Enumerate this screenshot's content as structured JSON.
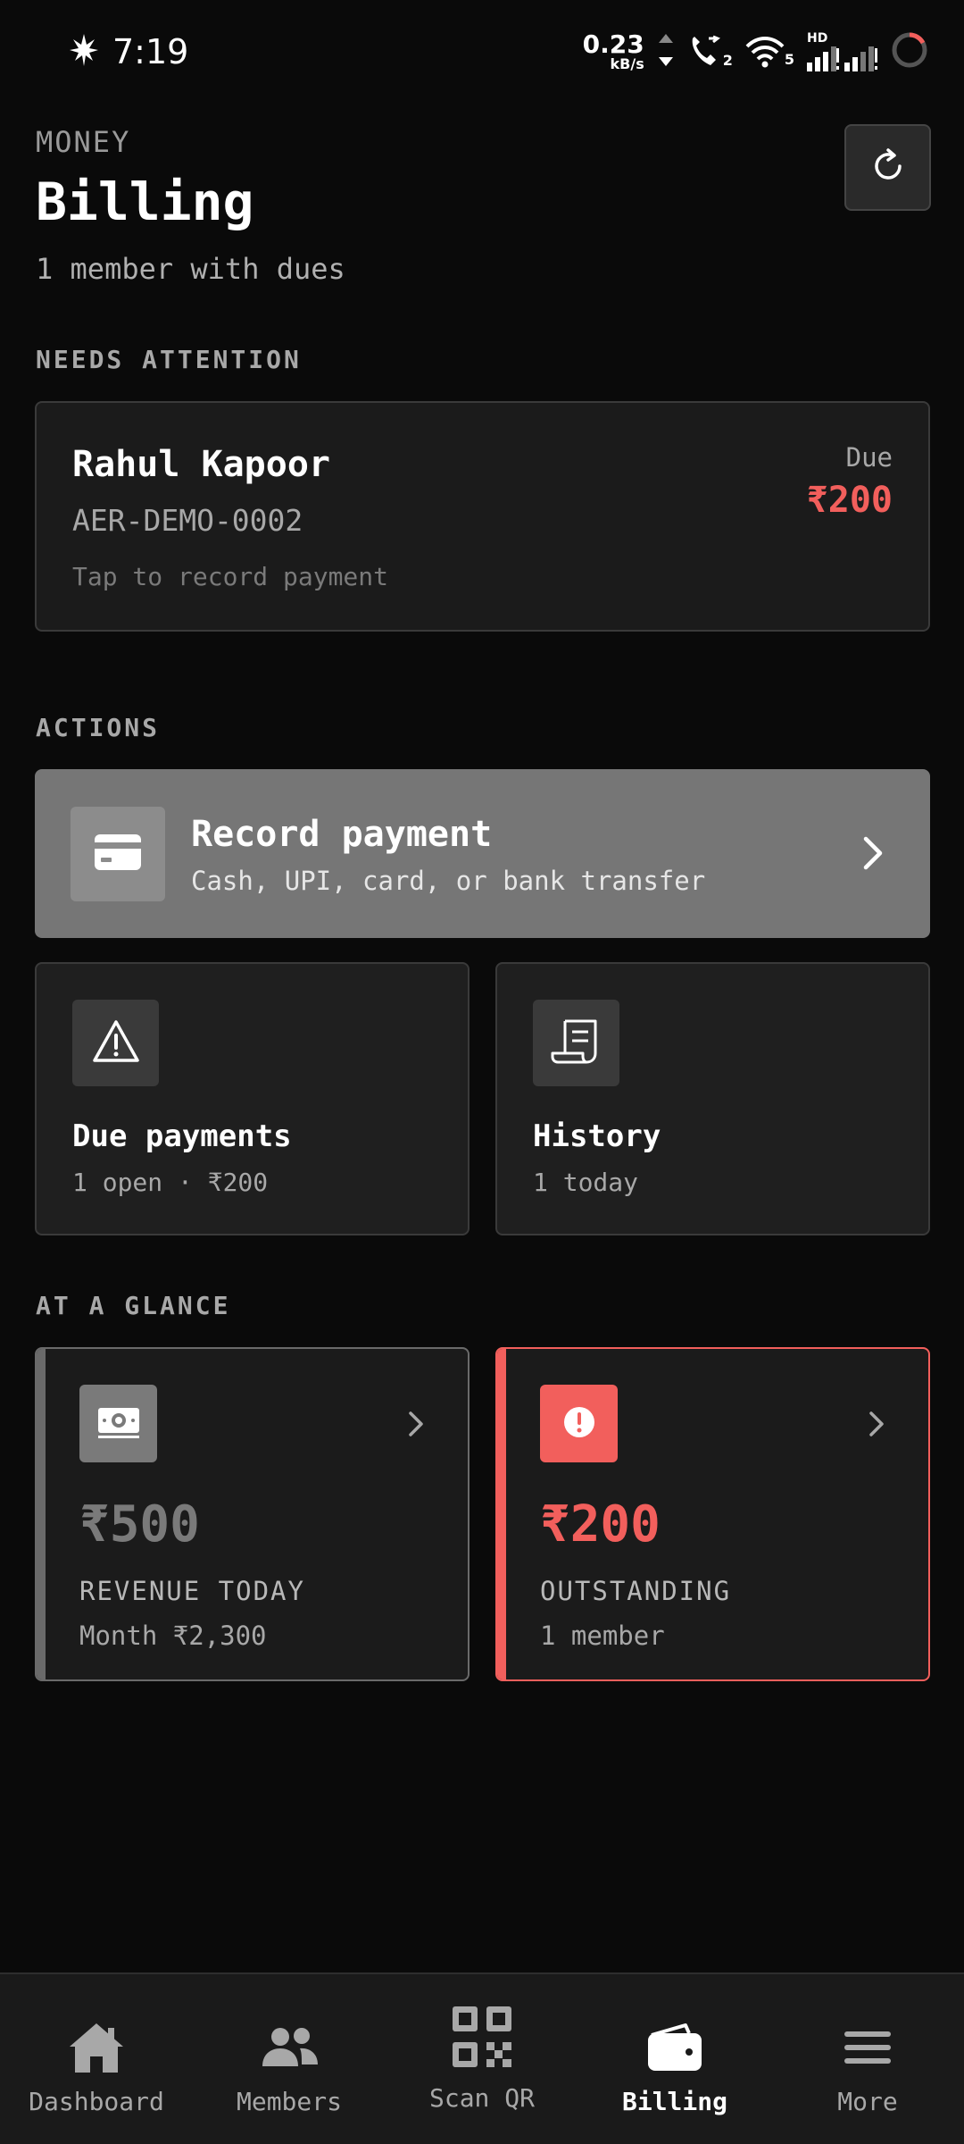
{
  "status_bar": {
    "time": "7:19",
    "net_speed_value": "0.23",
    "net_speed_unit": "kB/s",
    "call_badge": "2",
    "wifi_badge": "5",
    "hd_label": "HD"
  },
  "header": {
    "eyebrow": "MONEY",
    "title": "Billing",
    "subtitle": "1 member with dues"
  },
  "needs_attention": {
    "label": "NEEDS ATTENTION",
    "member_name": "Rahul Kapoor",
    "member_code": "AER-DEMO-0002",
    "hint": "Tap to record payment",
    "due_label": "Due",
    "due_amount": "₹200"
  },
  "actions": {
    "label": "ACTIONS",
    "record": {
      "title": "Record payment",
      "subtitle": "Cash, UPI, card, or bank transfer"
    },
    "due_payments": {
      "title": "Due payments",
      "subtitle": "1 open · ₹200"
    },
    "history": {
      "title": "History",
      "subtitle": "1 today"
    }
  },
  "at_a_glance": {
    "label": "AT A GLANCE",
    "revenue": {
      "amount": "₹500",
      "label": "REVENUE TODAY",
      "subtitle": "Month ₹2,300"
    },
    "outstanding": {
      "amount": "₹200",
      "label": "OUTSTANDING",
      "subtitle": "1 member"
    }
  },
  "bottom_nav": {
    "items": [
      {
        "label": "Dashboard",
        "icon": "home-icon"
      },
      {
        "label": "Members",
        "icon": "users-icon"
      },
      {
        "label": "Scan QR",
        "icon": "qr-code-icon"
      },
      {
        "label": "Billing",
        "icon": "wallet-icon",
        "active": true
      },
      {
        "label": "More",
        "icon": "menu-icon"
      }
    ]
  },
  "colors": {
    "background": "#0a0a0a",
    "danger": "#f25f5c",
    "neutral_accent": "#767676"
  }
}
